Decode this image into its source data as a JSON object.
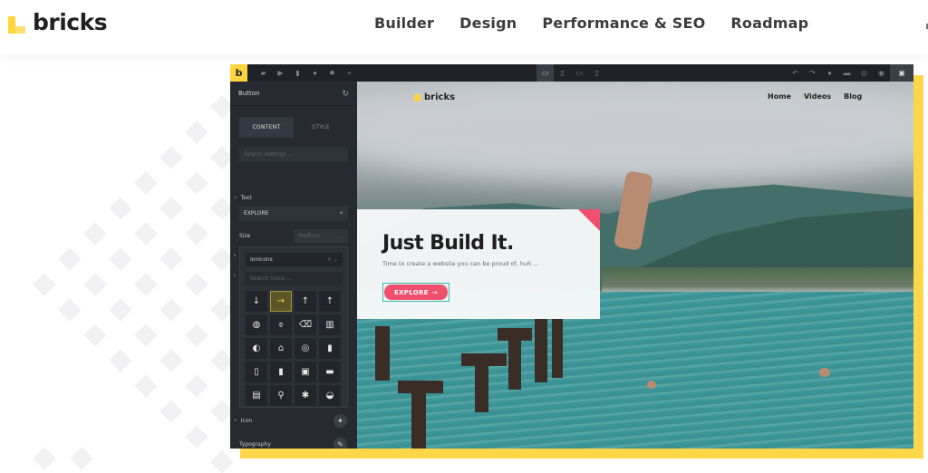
{
  "site": {
    "brand": "bricks",
    "nav": [
      "Builder",
      "Design",
      "Performance & SEO",
      "Roadmap"
    ],
    "accent_color": "#ffd53e"
  },
  "builder": {
    "logo_letter": "b",
    "toolbar_left_icons": [
      "briefcase-icon",
      "cursor-icon",
      "page-icon",
      "history-icon",
      "settings-icon",
      "plus-icon"
    ],
    "device_icons": [
      "desktop-icon",
      "tablet-icon",
      "tablet-landscape-icon",
      "mobile-icon"
    ],
    "toolbar_right_icons": [
      "undo-icon",
      "redo-icon",
      "help-icon",
      "folder-icon",
      "wordpress-icon",
      "preview-icon"
    ],
    "save_icon": "save-icon",
    "panel": {
      "title": "Button",
      "tabs": [
        "CONTENT",
        "STYLE"
      ],
      "active_tab": "CONTENT",
      "search_placeholder": "Search settings ...",
      "text_label": "Text",
      "text_value": "EXPLORE",
      "size_label": "Size",
      "size_value": "Medium",
      "icon_library": "Ionicons",
      "icon_search_placeholder": "Search icons ...",
      "icons": [
        "↓",
        "→",
        "↑",
        "↑",
        "◍",
        "⌽",
        "⌫",
        "▥",
        "◐",
        "⌂",
        "◎",
        "▮",
        "▯",
        "▮",
        "▣",
        "▬",
        "▤",
        "⚲",
        "✱",
        "◒"
      ],
      "selected_icon_index": 1,
      "icon_label": "Icon",
      "typography_label": "Typography"
    }
  },
  "preview": {
    "brand": "bricks",
    "nav": [
      "Home",
      "Videos",
      "Blog"
    ],
    "hero_title": "Just Build It.",
    "hero_subtitle": "Time to create a website you can be proud of, huh ...",
    "button_label": "EXPLORE",
    "button_arrow": "→",
    "button_color": "#f0506e"
  }
}
